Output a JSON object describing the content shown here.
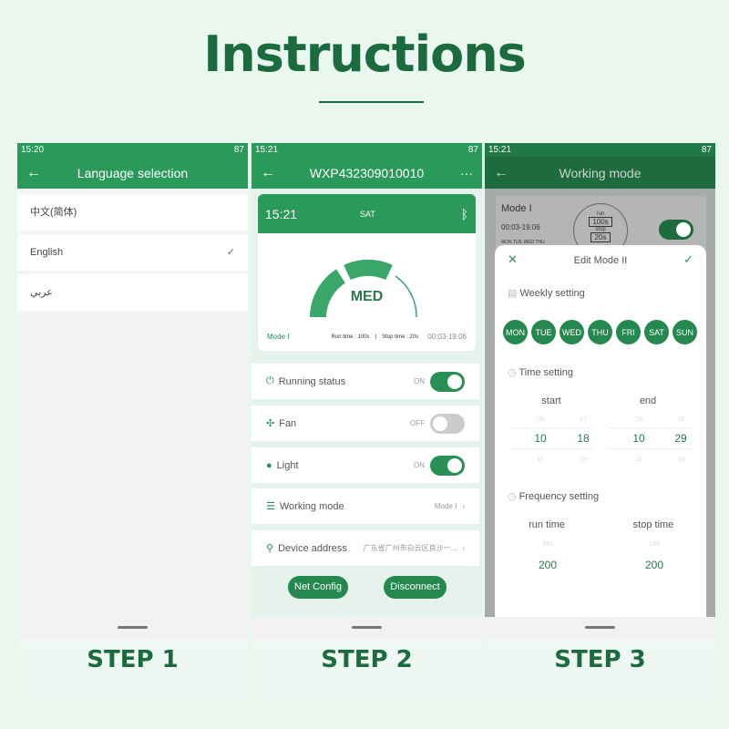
{
  "title": "Instructions",
  "step1": {
    "status": {
      "time": "15:20",
      "battery": "87"
    },
    "header": "Language selection",
    "languages": [
      {
        "label": "中文(简体)"
      },
      {
        "label": "English",
        "selected": true
      },
      {
        "label": "عربي"
      }
    ],
    "step": "STEP 1"
  },
  "step2": {
    "status": {
      "time": "15:21",
      "battery": "87"
    },
    "header": "WXP432309010010",
    "card": {
      "time": "15:21",
      "day": "SAT",
      "level": "MED",
      "mode": "Mode I",
      "run": "Run time : 100s",
      "sep": "|",
      "stop": "Stop time : 20s",
      "range": "00:03-19:06"
    },
    "rows": [
      {
        "label": "Running status",
        "state": "ON"
      },
      {
        "label": "Fan",
        "state": "OFF"
      },
      {
        "label": "Light",
        "state": "ON"
      },
      {
        "label": "Working mode",
        "value": "Mode I"
      },
      {
        "label": "Device address",
        "value": "广东省广州市白云区良沙一..."
      }
    ],
    "net_config": "Net Config",
    "disconnect": "Disconnect",
    "step": "STEP 2"
  },
  "step3": {
    "status": {
      "time": "15:21",
      "battery": "87"
    },
    "header": "Working mode",
    "mode_card": {
      "name": "Mode I",
      "range": "00:03-19:06",
      "days": "MON TUE WED THU",
      "run_label": "run",
      "run": "100s",
      "stop_label": "stop",
      "stop": "20s"
    },
    "sheet": {
      "title": "Edit Mode II",
      "weekly": "Weekly setting",
      "days": [
        "MON",
        "TUE",
        "WED",
        "THU",
        "FRI",
        "SAT",
        "SUN"
      ],
      "time_setting": "Time setting",
      "start": "start",
      "end": "end",
      "start_h": "10",
      "start_m": "18",
      "end_h": "10",
      "end_m": "29",
      "start_h_prev": "09",
      "start_m_prev": "17",
      "start_h_next": "11",
      "start_m_next": "19",
      "end_h_prev": "09",
      "end_m_prev": "28",
      "end_h_next": "11",
      "end_m_next": "30",
      "frequency": "Frequency setting",
      "run_time": "run time",
      "stop_time": "stop time",
      "run_val": "200",
      "stop_val": "200",
      "run_prev": "195",
      "stop_prev": "195"
    },
    "step": "STEP 3"
  },
  "colors": {
    "accent": "#2a9a5a",
    "dark": "#1b6b3f"
  }
}
